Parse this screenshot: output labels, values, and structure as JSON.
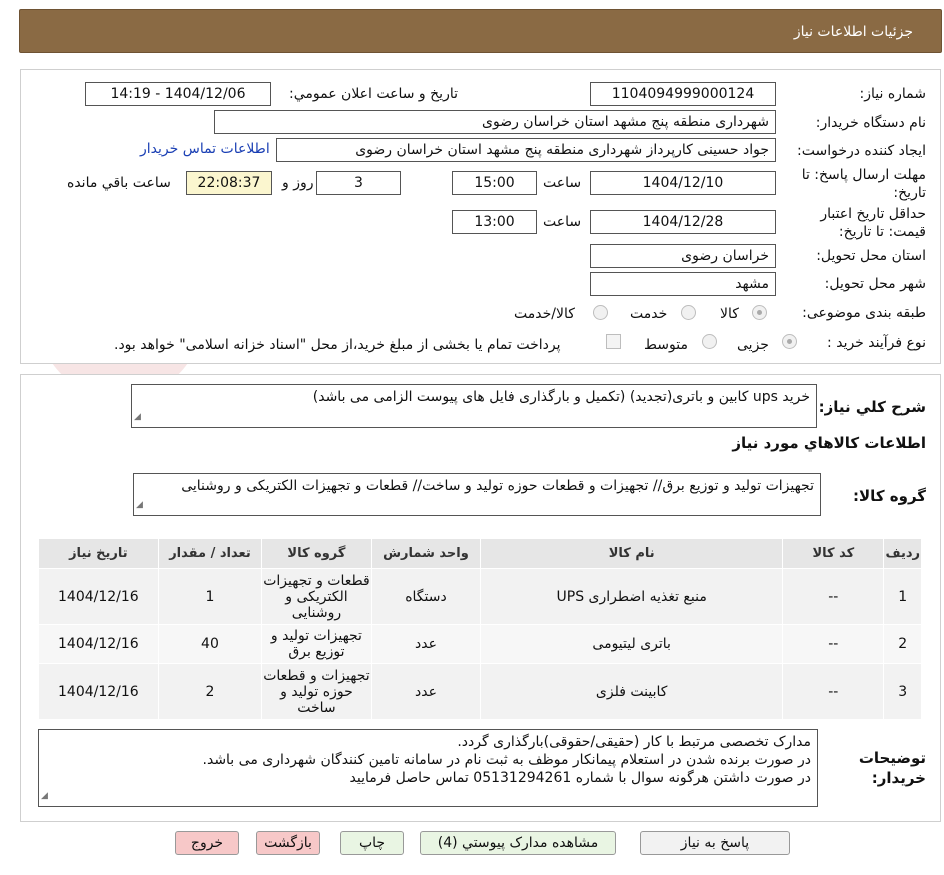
{
  "header": {
    "title": "جزئیات اطلاعات نیاز"
  },
  "watermark": {
    "text": "AriaTender.neT"
  },
  "form": {
    "need_number_label": "شماره نیاز:",
    "need_number": "1104094999000124",
    "announce_label": "تاریخ و ساعت اعلان عمومي:",
    "announce_value": "1404/12/06 - 14:19",
    "buyer_org_label": "نام دستگاه خريدار:",
    "buyer_org": "شهرداری منطقه پنج مشهد استان خراسان رضوی",
    "requester_label": "ایجاد کننده درخواست:",
    "requester": "جواد حسینی کارپرداز شهرداری منطقه پنج مشهد استان خراسان رضوی",
    "contact_link": "اطلاعات تماس خریدار",
    "deadline_label": "مهلت ارسال پاسخ: تا تاریخ:",
    "deadline_date": "1404/12/10",
    "time_label": "ساعت",
    "deadline_time": "15:00",
    "days_value": "3",
    "days_label": "روز و",
    "remaining_value": "22:08:37",
    "remaining_label": "ساعت باقي مانده",
    "validity_label": "حداقل تاریخ اعتبار قیمت: تا تاریخ:",
    "validity_date": "1404/12/28",
    "validity_time": "13:00",
    "province_label": "استان محل تحویل:",
    "province": "خراسان رضوی",
    "city_label": "شهر محل تحویل:",
    "city": "مشهد",
    "category_label": "طبقه بندی موضوعی:",
    "category_options": [
      "کالا",
      "خدمت",
      "کالا/خدمت"
    ],
    "process_label": "نوع فرآیند خرید :",
    "process_options": [
      "جزیی",
      "متوسط"
    ],
    "payment_note": "پرداخت تمام یا بخشی از مبلغ خرید،از محل \"اسناد خزانه اسلامی\" خواهد بود."
  },
  "summary": {
    "label": "شرح کلي نياز:",
    "text": "خرید ups  کابین و باتری(تجدید) (تکمیل و بارگذاری فایل های پیوست الزامی می باشد)",
    "goods_info_title": "اطلاعات کالاهاي مورد نياز",
    "group_label": "گروه کالا:",
    "group_text": "تجهیزات تولید و توزیع برق// تجهیزات و قطعات حوزه تولید و ساخت// قطعات و تجهیزات الکتریکی و روشنایی"
  },
  "table": {
    "headers": [
      "رديف",
      "کد کالا",
      "نام کالا",
      "واحد شمارش",
      "گروه کالا",
      "تعداد / مقدار",
      "تاریخ نیاز"
    ],
    "rows": [
      [
        "1",
        "--",
        "منبع تغذیه اضطراری UPS",
        "دستگاه",
        "قطعات و تجهیزات الکتریکی و روشنایی",
        "1",
        "1404/12/16"
      ],
      [
        "2",
        "--",
        "باتری لیتیومی",
        "عدد",
        "تجهیزات تولید و توزیع برق",
        "40",
        "1404/12/16"
      ],
      [
        "3",
        "--",
        "کابینت فلزی",
        "عدد",
        "تجهیزات و قطعات حوزه تولید و ساخت",
        "2",
        "1404/12/16"
      ]
    ]
  },
  "buyer_notes": {
    "label": "توضیحات خریدار:",
    "line1": "مدارک تخصصی مرتبط با کار (حقیقی/حقوقی)بارگذاری گردد.",
    "line2": "در صورت برنده شدن در استعلام پیمانکار موظف به ثبت نام در سامانه تامین کنندگان شهرداری می باشد.",
    "line3": "در صورت داشتن هرگونه سوال  با شماره 05131294261 تماس حاصل فرمایید"
  },
  "buttons": {
    "reply": "پاسخ به نیاز",
    "attachments": "مشاهده مدارک پیوستي (4)",
    "print": "چاپ",
    "back": "بازگشت",
    "exit": "خروج"
  },
  "colors": {
    "header_bg": "#8a6a44",
    "link": "#1a3fb4",
    "remaining_bg": "#fbf6cf",
    "back_btn": "#f7c8c8",
    "print_btn": "#e9f5e3"
  }
}
